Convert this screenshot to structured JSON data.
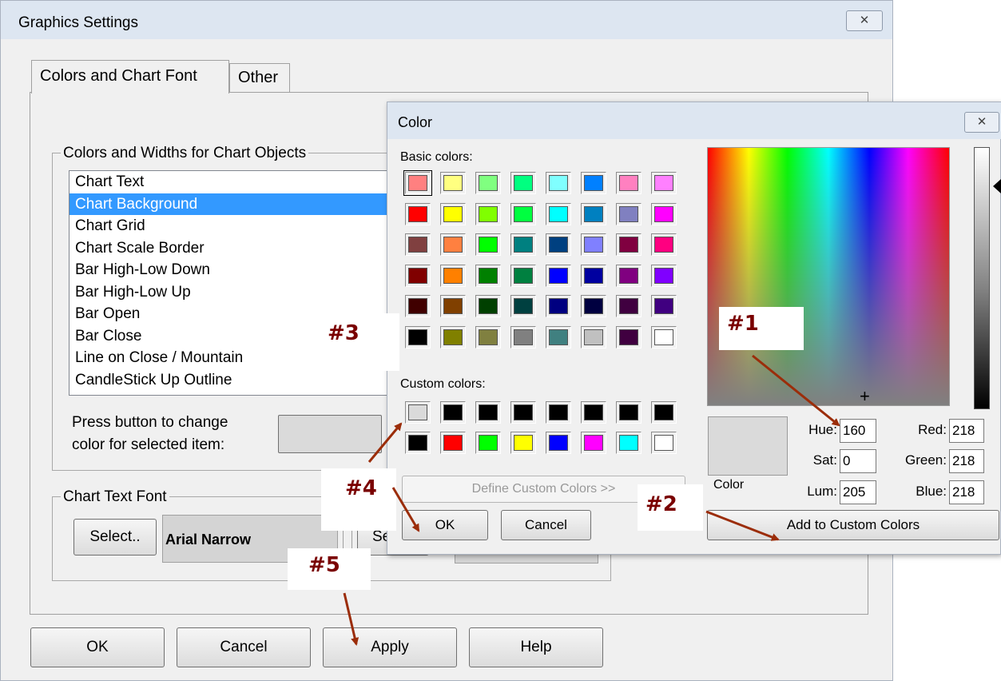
{
  "main_dialog": {
    "title": "Graphics Settings",
    "close_glyph": "✕",
    "tabs": [
      "Colors and Chart Font",
      "Other"
    ],
    "colors_group_title": "Colors and Widths for Chart Objects",
    "list_items": [
      "Chart Text",
      "Chart Background",
      "Chart Grid",
      "Chart Scale Border",
      "Bar High-Low Down",
      "Bar High-Low Up",
      "Bar Open",
      "Bar Close",
      "Line on Close / Mountain",
      "CandleStick Up Outline"
    ],
    "selected_index": 1,
    "press_label_line1": "Press button to change",
    "press_label_line2": "color for selected item:",
    "font_group_title": "Chart Text Font",
    "select_button": "Select..",
    "font_name": "Arial Narrow",
    "partial_button": "Se",
    "buttons": {
      "ok": "OK",
      "cancel": "Cancel",
      "apply": "Apply",
      "help": "Help"
    }
  },
  "color_dialog": {
    "title": "Color",
    "close_glyph": "✕",
    "basic_label": "Basic colors:",
    "basic_colors": [
      [
        "#ff8080",
        "#ffff80",
        "#80ff80",
        "#00ff80",
        "#80ffff",
        "#0080ff",
        "#ff80c0",
        "#ff80ff"
      ],
      [
        "#ff0000",
        "#ffff00",
        "#80ff00",
        "#00ff40",
        "#00ffff",
        "#0080c0",
        "#8080c0",
        "#ff00ff"
      ],
      [
        "#804040",
        "#ff8040",
        "#00ff00",
        "#008080",
        "#004080",
        "#8080ff",
        "#800040",
        "#ff0080"
      ],
      [
        "#800000",
        "#ff8000",
        "#008000",
        "#008040",
        "#0000ff",
        "#0000a0",
        "#800080",
        "#8000ff"
      ],
      [
        "#400000",
        "#804000",
        "#004000",
        "#004040",
        "#000080",
        "#000040",
        "#400040",
        "#400080"
      ],
      [
        "#000000",
        "#808000",
        "#808040",
        "#808080",
        "#408080",
        "#c0c0c0",
        "#400040",
        "#ffffff"
      ]
    ],
    "custom_label": "Custom colors:",
    "custom_colors": [
      [
        "#dadada",
        "#000000",
        "#000000",
        "#000000",
        "#000000",
        "#000000",
        "#000000",
        "#000000"
      ],
      [
        "#000000",
        "#ff0000",
        "#00ff00",
        "#ffff00",
        "#0000ff",
        "#ff00ff",
        "#00ffff",
        "#ffffff"
      ]
    ],
    "define_button": "Define Custom Colors >>",
    "ok_button": "OK",
    "cancel_button": "Cancel",
    "color_label": "Color",
    "preview_color": "#dadada",
    "hue_label": "Hue:",
    "hue": "160",
    "sat_label": "Sat:",
    "sat": "0",
    "lum_label": "Lum:",
    "lum": "205",
    "red_label": "Red:",
    "red": "218",
    "green_label": "Green:",
    "green": "218",
    "blue_label": "Blue:",
    "blue": "218",
    "add_button": "Add to Custom Colors"
  },
  "annotations": {
    "n1": "#1",
    "n2": "#2",
    "n3": "#3",
    "n4": "#4",
    "n5": "#5",
    "arrow_color": "#9b2d0a"
  }
}
